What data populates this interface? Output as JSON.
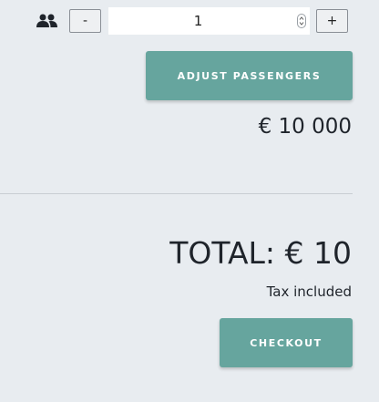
{
  "passengers": {
    "icon": "people-icon",
    "decrement_label": "-",
    "increment_label": "+",
    "quantity_value": "1",
    "adjust_button_label": "ADJUST PASSENGERS"
  },
  "pricing": {
    "price": "€ 10 000",
    "total": "TOTAL: € 10",
    "tax_note": "Tax included"
  },
  "checkout": {
    "button_label": "CHECKOUT"
  },
  "colors": {
    "background": "#e8ecf0",
    "accent": "#66a59e",
    "text": "#1f242b"
  }
}
